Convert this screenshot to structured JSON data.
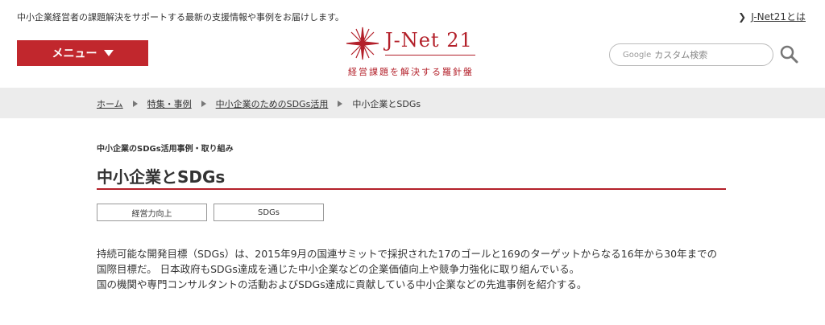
{
  "header": {
    "tagline": "中小企業経営者の課題解決をサポートする最新の支援情報や事例をお届けします。",
    "about_link": "J-Net21とは",
    "menu_label": "メニュー",
    "logo_text": "J-Net 21",
    "logo_subtitle": "経営課題を解決する羅針盤",
    "search_brand": "Google",
    "search_placeholder": "カスタム検索"
  },
  "breadcrumb": {
    "items": [
      "ホーム",
      "特集・事例",
      "中小企業のためのSDGs活用",
      "中小企業とSDGs"
    ]
  },
  "article": {
    "category": "中小企業のSDGs活用事例・取り組み",
    "title": "中小企業とSDGs",
    "tags": [
      "経営力向上",
      "SDGs"
    ],
    "paragraph_lines": [
      "持続可能な開発目標（SDGs）は、2015年9月の国連サミットで採択された17のゴールと169のターゲットからなる16年から30年までの",
      "国際目標だ。 日本政府もSDGs達成を通じた中小企業などの企業価値向上や競争力強化に取り組んでいる。",
      "国の機関や専門コンサルタントの活動およびSDGs達成に貢献している中小企業などの先進事例を紹介する。"
    ]
  },
  "colors": {
    "accent": "#c1272d",
    "breadcrumb_bg": "#ececec",
    "text": "#333333"
  }
}
